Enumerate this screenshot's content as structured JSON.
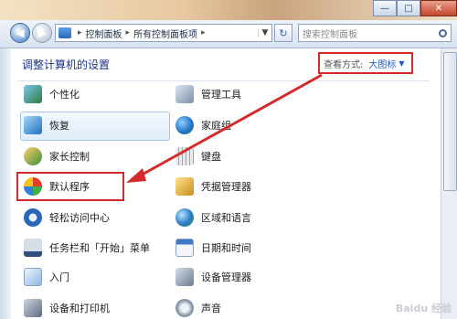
{
  "window": {
    "buttons": {
      "minimize": "—",
      "maximize": "□",
      "close": "✕"
    }
  },
  "address": {
    "segments": [
      "控制面板",
      "所有控制面板项"
    ],
    "refresh_icon": "refresh-icon",
    "search_placeholder": "搜索控制面板"
  },
  "header": {
    "title": "调整计算机的设置",
    "view_by_label": "查看方式:",
    "view_by_value": "大图标"
  },
  "items_left": [
    {
      "label": "个性化",
      "icon": "personalization-icon"
    },
    {
      "label": "恢复",
      "icon": "recovery-icon"
    },
    {
      "label": "家长控制",
      "icon": "parental-controls-icon"
    },
    {
      "label": "默认程序",
      "icon": "default-programs-icon"
    },
    {
      "label": "轻松访问中心",
      "icon": "ease-of-access-icon"
    },
    {
      "label": "任务栏和「开始」菜单",
      "icon": "taskbar-icon"
    },
    {
      "label": "入门",
      "icon": "getting-started-icon"
    },
    {
      "label": "设备和打印机",
      "icon": "devices-printers-icon"
    }
  ],
  "items_right": [
    {
      "label": "管理工具",
      "icon": "admin-tools-icon"
    },
    {
      "label": "家庭组",
      "icon": "homegroup-icon"
    },
    {
      "label": "键盘",
      "icon": "keyboard-icon"
    },
    {
      "label": "凭据管理器",
      "icon": "credential-manager-icon"
    },
    {
      "label": "区域和语言",
      "icon": "region-language-icon"
    },
    {
      "label": "日期和时间",
      "icon": "date-time-icon"
    },
    {
      "label": "设备管理器",
      "icon": "device-manager-icon"
    },
    {
      "label": "声音",
      "icon": "sound-icon"
    }
  ],
  "colors": {
    "link": "#1e3287",
    "annotation_red": "#d32b2b"
  },
  "watermark": "Baidu 经验"
}
